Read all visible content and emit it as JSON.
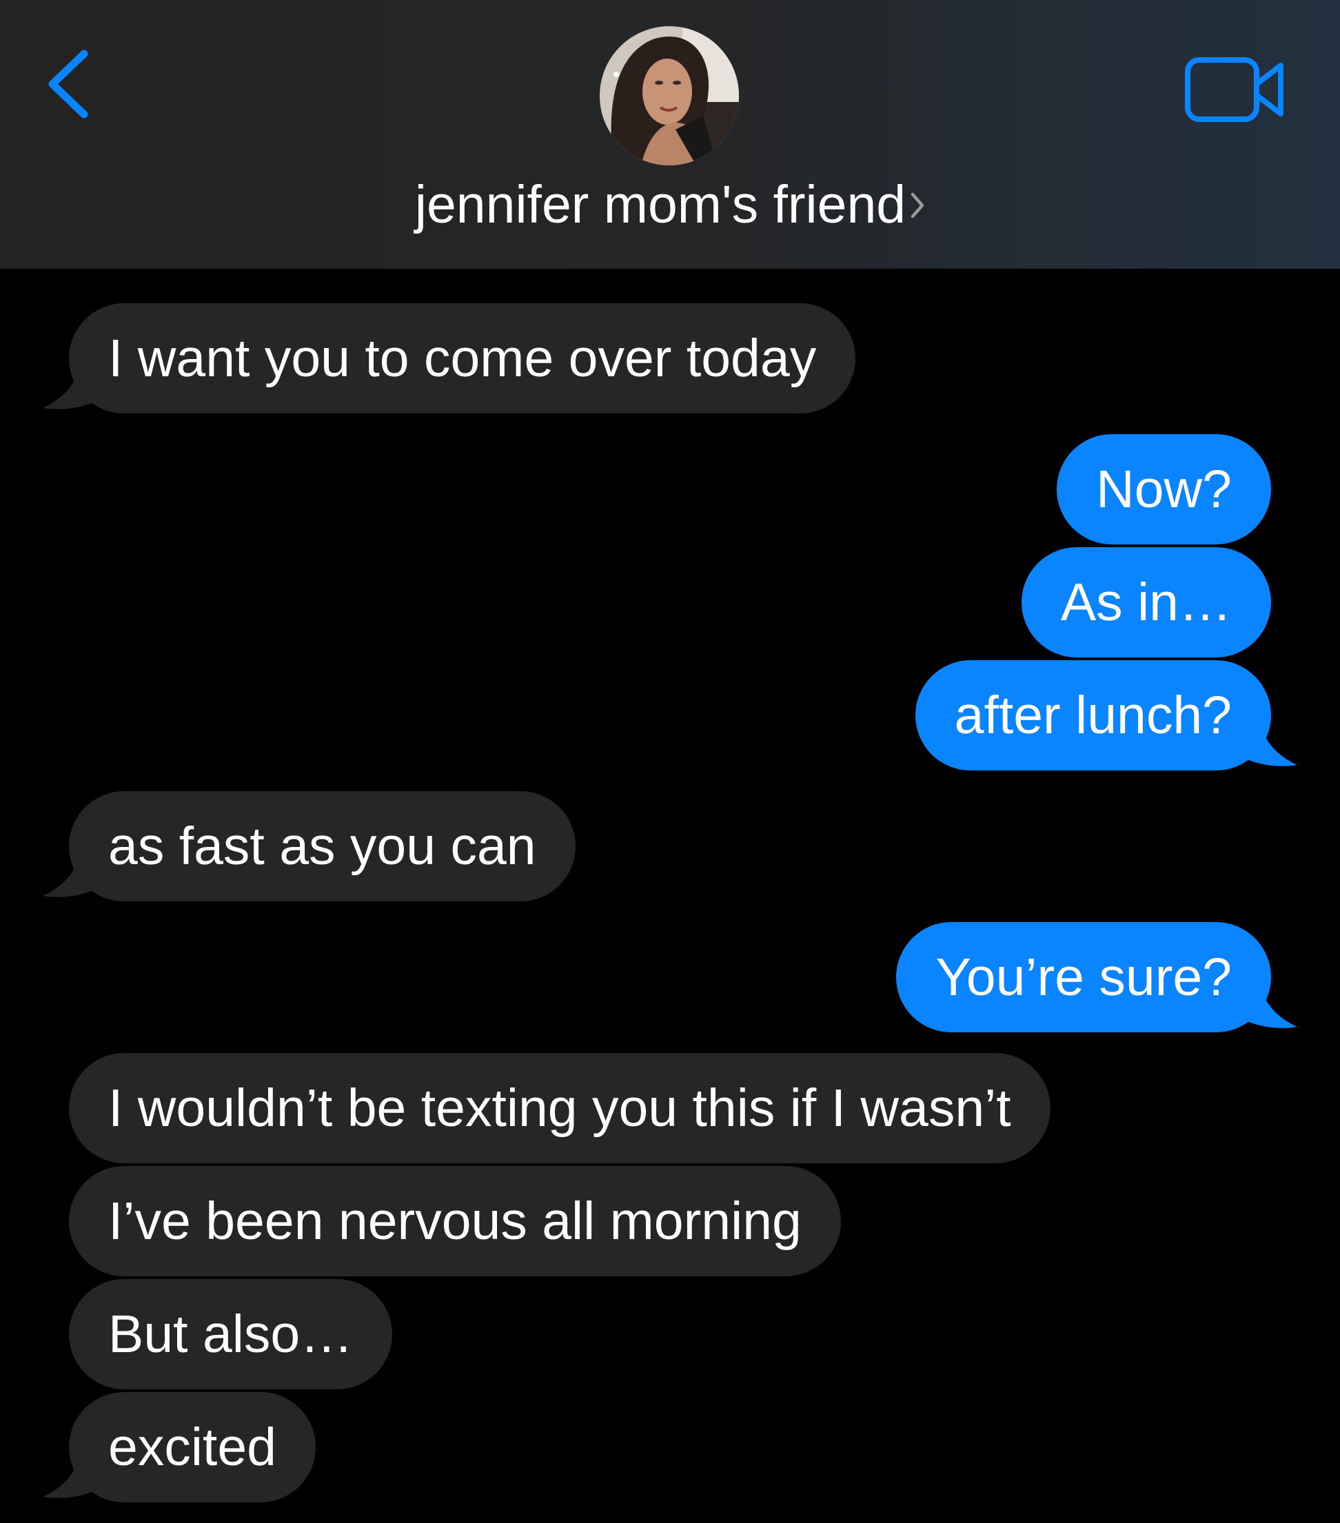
{
  "header": {
    "contact_name": "jennifer mom's friend",
    "back_icon": "chevron-left-icon",
    "info_icon": "chevron-right-icon",
    "video_icon": "video-camera-icon"
  },
  "colors": {
    "accent": "#0a84ff",
    "incoming_bubble": "#262628",
    "outgoing_bubble": "#0a84ff",
    "background": "#000000"
  },
  "messages": [
    {
      "direction": "incoming",
      "text": "I want you to come over today"
    },
    {
      "direction": "outgoing",
      "text": "Now?"
    },
    {
      "direction": "outgoing",
      "text": "As in…"
    },
    {
      "direction": "outgoing",
      "text": "after lunch?"
    },
    {
      "direction": "incoming",
      "text": "as fast as you can"
    },
    {
      "direction": "outgoing",
      "text": "You’re sure?"
    },
    {
      "direction": "incoming",
      "text": "I wouldn’t be texting you this if I wasn’t"
    },
    {
      "direction": "incoming",
      "text": "I’ve been nervous all morning"
    },
    {
      "direction": "incoming",
      "text": "But also…"
    },
    {
      "direction": "incoming",
      "text": "excited"
    }
  ]
}
